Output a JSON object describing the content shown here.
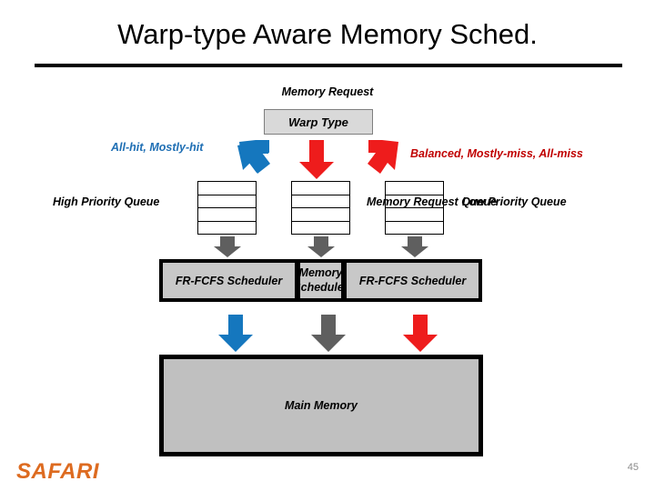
{
  "slide": {
    "title": "Warp-type Aware Memory Sched.",
    "page_number": "45",
    "logo": "SAFARI"
  },
  "diagram": {
    "source_label": "Memory Request",
    "classifier_box": "Warp Type",
    "branch_labels": {
      "left": "All-hit, Mostly-hit",
      "right": "Balanced, Mostly-miss, All-miss"
    },
    "queues": [
      {
        "label": "High Priority Queue",
        "rows": 4
      },
      {
        "label": "Memory Request Queue",
        "rows": 4
      },
      {
        "label": "Low Priority Queue",
        "rows": 4
      }
    ],
    "schedulers": [
      {
        "label": "FR-FCFS Scheduler"
      },
      {
        "label": "Memory Scheduler",
        "line1": "Memory",
        "line2": "Scheduler"
      },
      {
        "label": "FR-FCFS Scheduler"
      }
    ],
    "memory_box": "Main Memory",
    "colors": {
      "blue": "#1577be",
      "red": "#ee1c1c",
      "gray": "#5f5f5f",
      "label_blue": "#1f6fb4",
      "label_red": "#c00000",
      "box_fill": "#c8c8c8",
      "classifier_fill": "#d9d9d9",
      "logo_orange": "#dd6b20"
    }
  }
}
